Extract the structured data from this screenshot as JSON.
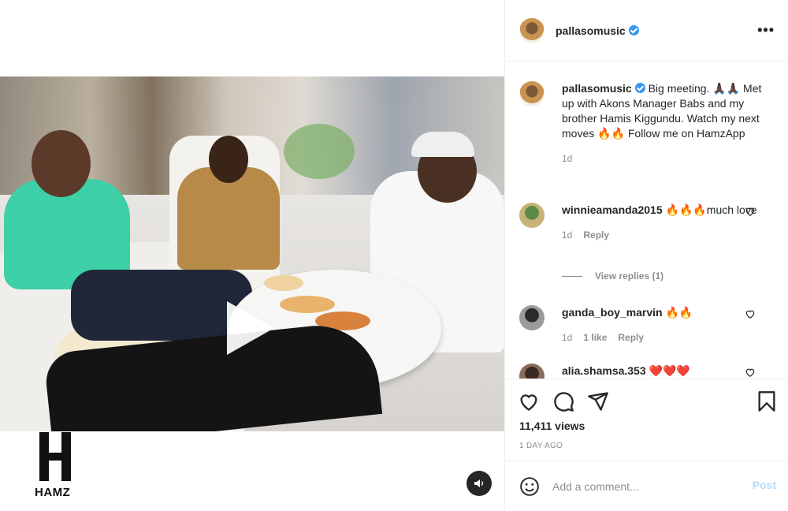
{
  "post": {
    "username": "pallasomusic",
    "verified": true,
    "caption": "Big meeting. 🙏🏿🙏🏿 Met up with Akons Manager Babs and my brother Hamis Kiggundu. Watch my next moves 🔥🔥 Follow me on HamzApp",
    "caption_time": "1d",
    "views": "11,411 views",
    "date": "1 DAY AGO"
  },
  "comments": [
    {
      "username": "winnieamanda2015",
      "text": "🔥🔥🔥much love",
      "time": "1d",
      "reply_label": "Reply",
      "view_replies": "View replies (1)"
    },
    {
      "username": "ganda_boy_marvin",
      "text": "🔥🔥",
      "time": "1d",
      "likes": "1 like",
      "reply_label": "Reply"
    },
    {
      "username": "alia.shamsa.353",
      "text": "❤️❤️❤️"
    }
  ],
  "media": {
    "brand_text": "HAMZ"
  },
  "add_comment": {
    "placeholder": "Add a comment...",
    "post_label": "Post"
  },
  "icons": {
    "more": "more-options-icon",
    "like": "heart-icon",
    "comment": "comment-icon",
    "share": "share-icon",
    "save": "bookmark-icon",
    "emoji": "emoji-icon",
    "mute": "speaker-icon",
    "play": "play-icon"
  },
  "colors": {
    "accent": "#3897f0",
    "post_disabled": "#b3dbff",
    "muted_text": "#8e8e8e"
  }
}
